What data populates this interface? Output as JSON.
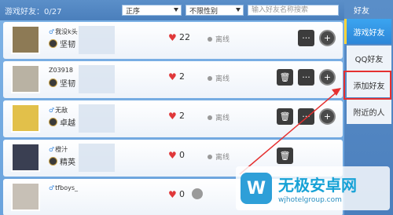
{
  "header": {
    "friend_count_label": "游戏好友：0/27",
    "sort_select": "正序",
    "gender_select": "不限性别",
    "search_placeholder": "输入好友名称搜索"
  },
  "sidebar": {
    "title": "好友",
    "tabs": [
      {
        "label": "游戏好友"
      },
      {
        "label": "QQ好友"
      },
      {
        "label": "添加好友"
      },
      {
        "label": "附近的人"
      }
    ]
  },
  "friends": [
    {
      "name": "我没k头",
      "sex": "♂",
      "tier": "坚韧",
      "likes": "22",
      "status": "离线",
      "avatar_color": "#8d7a55"
    },
    {
      "name": "Z03918",
      "sex": "",
      "tier": "坚韧",
      "likes": "2",
      "status": "离线",
      "avatar_color": "#b9b2a3"
    },
    {
      "name": "无敌",
      "sex": "♂",
      "tier": "卓越",
      "likes": "2",
      "status": "离线",
      "avatar_color": "#e2c04a"
    },
    {
      "name": "橙汁",
      "sex": "♂",
      "tier": "精英",
      "likes": "0",
      "status": "离线",
      "avatar_color": "#3a3f52"
    },
    {
      "name": "tfboys_",
      "sex": "♂",
      "tier": "",
      "likes": "0",
      "status": "",
      "avatar_color": "#c7c0b6"
    }
  ],
  "watermark": {
    "logo_char": "W",
    "title": "无极安卓网",
    "url": "wjhotelgroup.com"
  },
  "colors": {
    "accent_red": "#e53030",
    "heart": "#e0383a",
    "active_tab": "#2d87d8"
  }
}
